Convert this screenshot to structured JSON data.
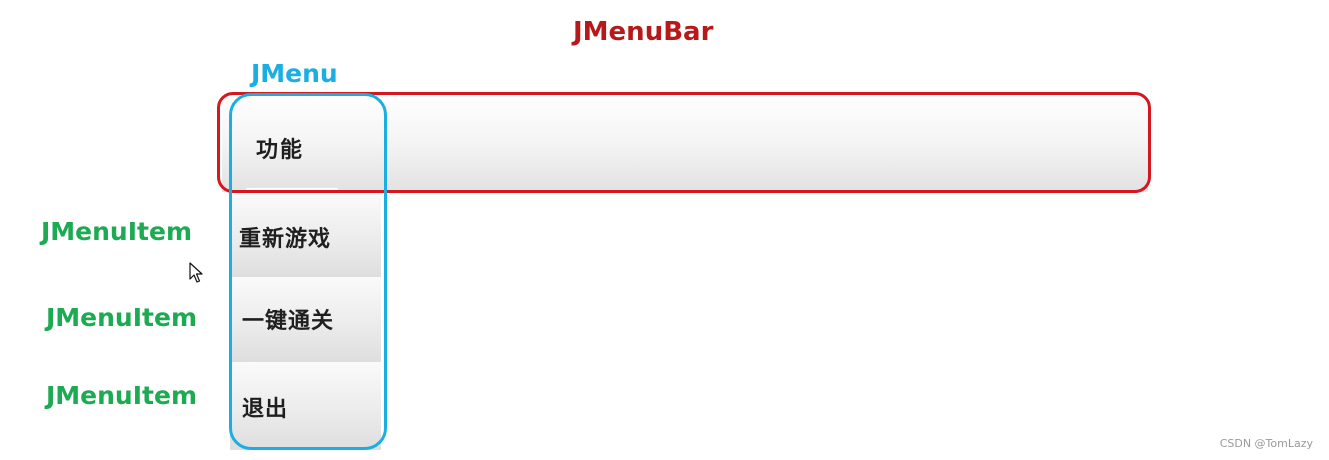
{
  "labels": {
    "menubar": "JMenuBar",
    "menu": "JMenu",
    "menu_item_1": "JMenuItem",
    "menu_item_2": "JMenuItem",
    "menu_item_3": "JMenuItem"
  },
  "menubar": {
    "menu_title": "功能"
  },
  "menu_items": [
    {
      "label": "重新游戏"
    },
    {
      "label": "一键通关"
    },
    {
      "label": "退出"
    }
  ],
  "watermark": "CSDN @TomLazy",
  "colors": {
    "menubar_label": "#b7191b",
    "menu_label": "#1aaee3",
    "menu_item_label": "#1caa52",
    "menubar_frame": "#d5181d",
    "menu_frame": "#1aaee3"
  },
  "icons": {
    "cursor": "mouse-pointer-icon"
  }
}
